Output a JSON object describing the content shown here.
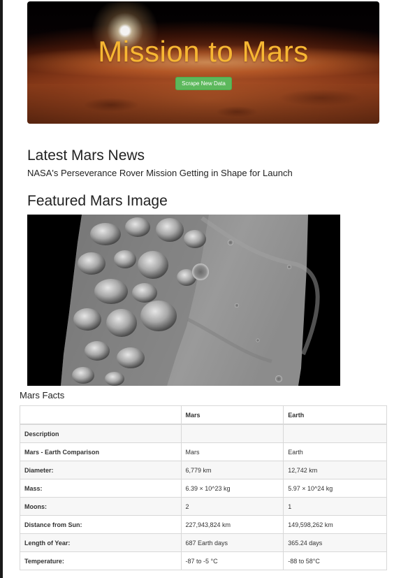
{
  "header": {
    "title": "Mission to Mars",
    "scrape_button_label": "Scrape New Data"
  },
  "news": {
    "heading": "Latest Mars News",
    "title": "NASA's Perseverance Rover Mission Getting in Shape for Launch"
  },
  "featured": {
    "heading": "Featured Mars Image"
  },
  "facts": {
    "label": "Mars Facts",
    "columns": [
      "",
      "Mars",
      "Earth"
    ],
    "rows": [
      {
        "label": "Description",
        "mars": "",
        "earth": ""
      },
      {
        "label": "Mars - Earth Comparison",
        "mars": "Mars",
        "earth": "Earth"
      },
      {
        "label": "Diameter:",
        "mars": "6,779 km",
        "earth": "12,742 km"
      },
      {
        "label": "Mass:",
        "mars": "6.39 × 10^23 kg",
        "earth": "5.97 × 10^24 kg"
      },
      {
        "label": "Moons:",
        "mars": "2",
        "earth": "1"
      },
      {
        "label": "Distance from Sun:",
        "mars": "227,943,824 km",
        "earth": "149,598,262 km"
      },
      {
        "label": "Length of Year:",
        "mars": "687 Earth days",
        "earth": "365.24 days"
      },
      {
        "label": "Temperature:",
        "mars": "-87 to -5 °C",
        "earth": "-88 to 58°C"
      }
    ]
  },
  "colors": {
    "title": "#f7b733",
    "button": "#5cb85c"
  }
}
